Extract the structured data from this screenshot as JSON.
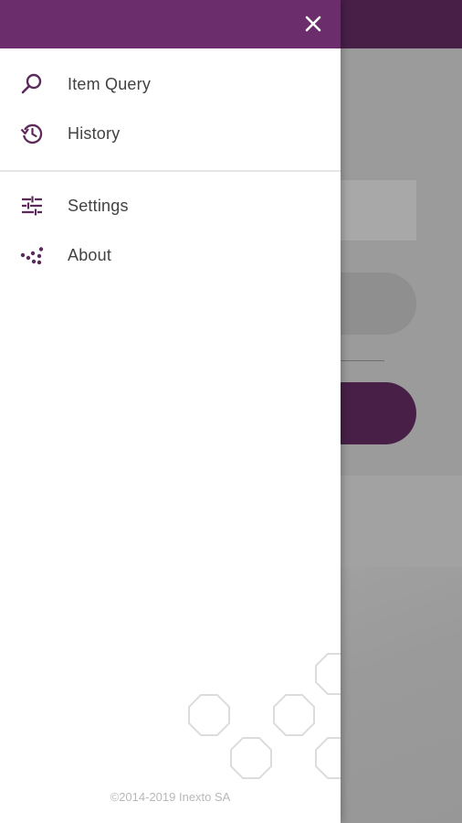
{
  "drawer": {
    "header_color": "#6b2d6b",
    "close_icon": "close-icon",
    "sections": [
      [
        {
          "label": "Item Query",
          "icon": "search-icon"
        },
        {
          "label": "History",
          "icon": "history-icon"
        }
      ],
      [
        {
          "label": "Settings",
          "icon": "tune-sliders-icon"
        },
        {
          "label": "About",
          "icon": "dots-logo-icon"
        }
      ]
    ],
    "footer": "©2014-2019 Inexto SA"
  },
  "colors": {
    "accent": "#6b2d6b",
    "accent_dark": "#471f47",
    "icon": "#5b2a5b",
    "text": "#424242"
  }
}
